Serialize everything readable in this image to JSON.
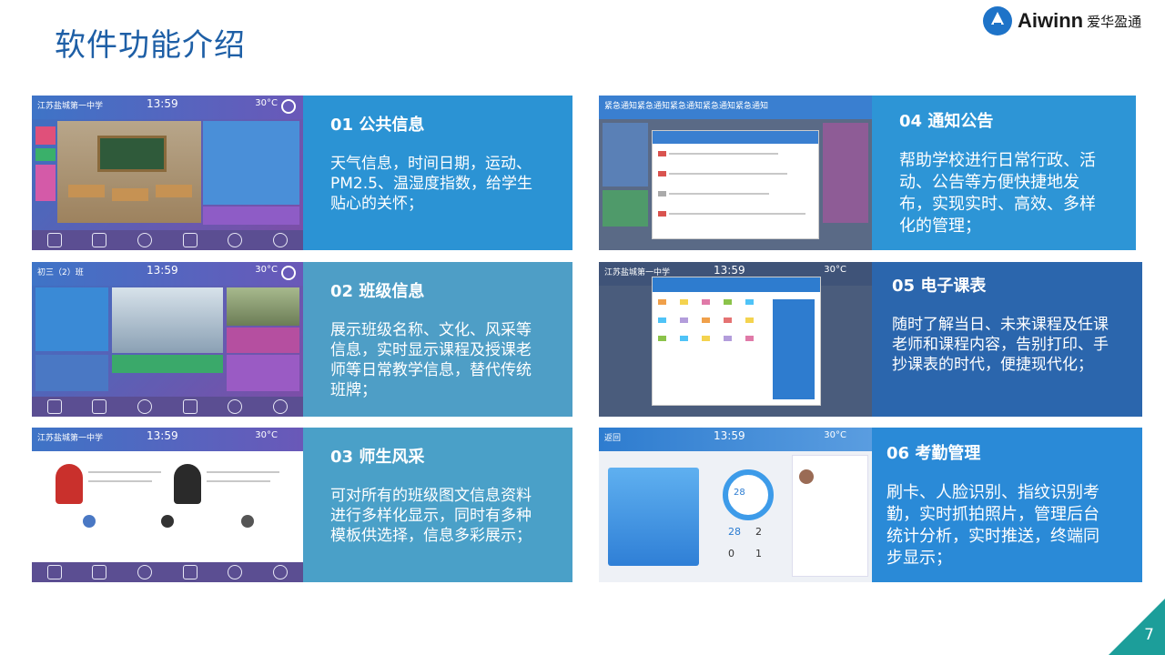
{
  "page_title": "软件功能介绍",
  "logo": {
    "brand": "Aiwinn",
    "brand_cn": "爱华盈通"
  },
  "page_number": "7",
  "cards": [
    {
      "title": "01 公共信息",
      "body": "天气信息，时间日期，运动、PM2.5、温湿度指数，给学生贴心的关怀；",
      "color": "#2b93d4"
    },
    {
      "title": "02 班级信息",
      "body": "展示班级名称、文化、风采等信息，实时显示课程及授课老师等日常教学信息，替代传统班牌；",
      "color": "#4e9ec6"
    },
    {
      "title": "03 师生风采",
      "body": "可对所有的班级图文信息资料进行多样化显示，同时有多种模板供选择，信息多彩展示；",
      "color": "#4aa0c8"
    },
    {
      "title": "04 通知公告",
      "body": "帮助学校进行日常行政、活动、公告等方便快捷地发布，实现实时、高效、多样化的管理；",
      "color": "#2d95d6"
    },
    {
      "title": "05 电子课表",
      "body": "随时了解当日、未来课程及任课老师和课程内容，告别打印、手抄课表的时代，便捷现代化；",
      "color": "#2b66ad"
    },
    {
      "title": "06 考勤管理",
      "body": "刷卡、人脸识别、指纹识别考勤，实时抓拍照片，管理后台统计分析，实时推送，终端同步显示；",
      "color": "#2a8ad7"
    }
  ],
  "screens": {
    "s1": {
      "school": "江苏盐城第一中学",
      "time": "13:59",
      "temp": "30°C"
    },
    "s2": {
      "school": "初三（2）班",
      "time": "13:59",
      "temp": "30°C"
    },
    "s3": {
      "school": "江苏盐城第一中学",
      "time": "13:59",
      "temp": "30°C"
    },
    "s4": {
      "banner": "紧急通知紧急通知紧急通知紧急通知紧急通知"
    },
    "s5": {
      "school": "江苏盐城第一中学",
      "time": "13:59",
      "temp": "30°C"
    },
    "s6": {
      "back": "返回",
      "time": "13:59",
      "temp": "30°C",
      "ring_value": "28",
      "stat_a": "28",
      "stat_b": "2",
      "stat_c": "0",
      "stat_d": "1"
    }
  }
}
